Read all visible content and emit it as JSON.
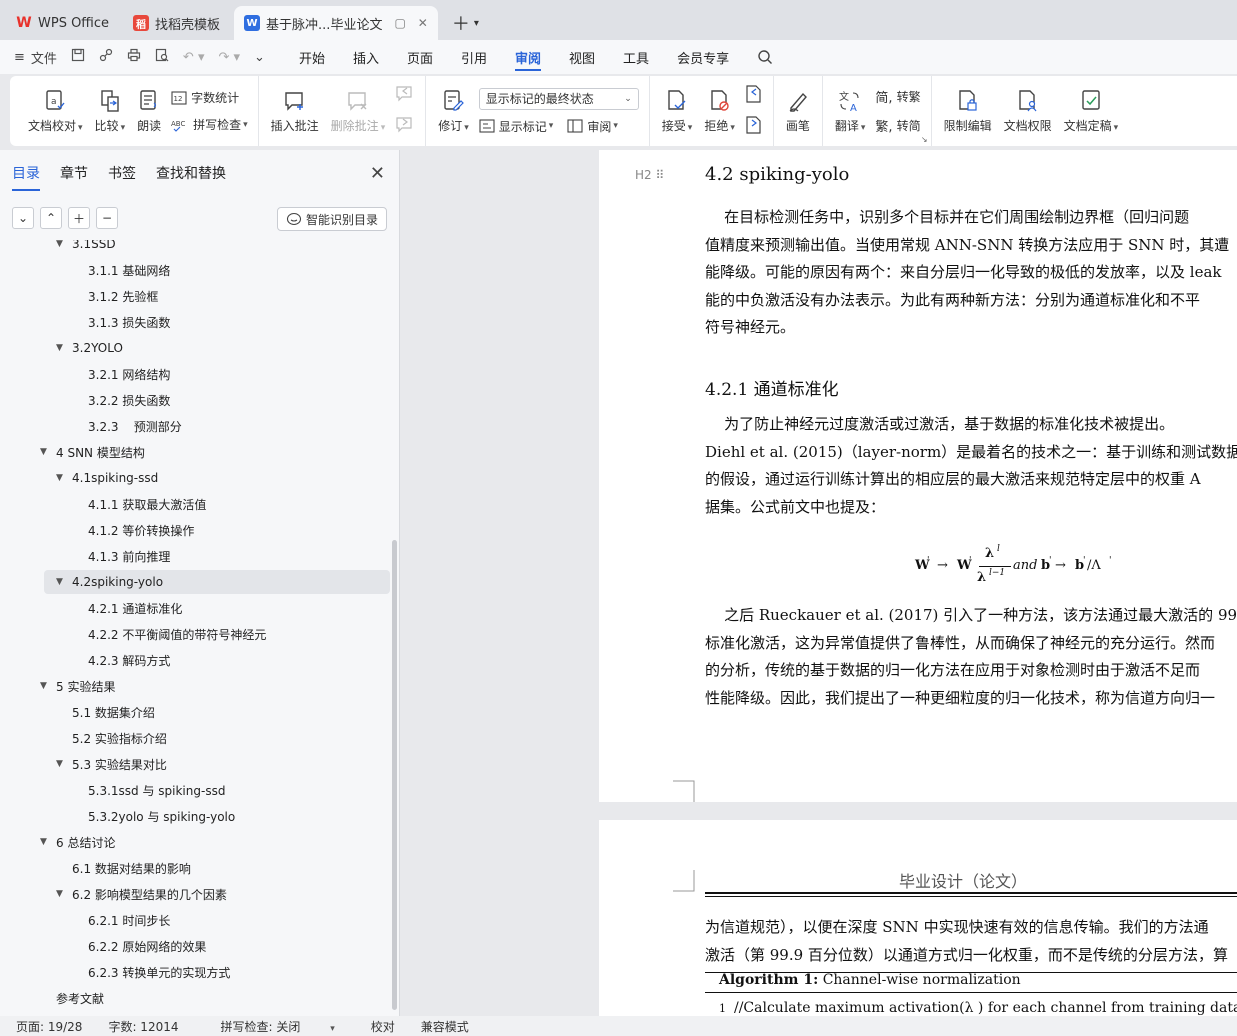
{
  "tabs": [
    {
      "label": "WPS Office",
      "logo": "wps-logo"
    },
    {
      "label": "找稻壳模板",
      "logo": "daoke-logo"
    },
    {
      "label": "基于脉冲...毕业论文",
      "logo": "writer-logo",
      "active": true
    }
  ],
  "menubar": {
    "file_label": "文件",
    "tabs": [
      "开始",
      "插入",
      "页面",
      "引用",
      "审阅",
      "视图",
      "工具",
      "会员专享"
    ],
    "active_tab": "审阅"
  },
  "ribbon": {
    "doc_check": "文档校对",
    "compare": "比较",
    "read_aloud": "朗读",
    "word_count": "字数统计",
    "spell_check": "拼写检查",
    "insert_comment": "插入批注",
    "delete_comment": "删除批注",
    "track_changes": "修订",
    "markup_state": "显示标记的最终状态",
    "show_markup": "显示标记",
    "review": "审阅",
    "accept": "接受",
    "reject": "拒绝",
    "pen": "画笔",
    "translate": "翻译",
    "to_traditional": "转繁",
    "to_simplified": "转简",
    "restrict_edit": "限制编辑",
    "doc_permission": "文档权限",
    "doc_finalize": "文档定稿"
  },
  "sidebar": {
    "tabs": [
      "目录",
      "章节",
      "书签",
      "查找和替换"
    ],
    "active_tab": "目录",
    "smart_toc": "智能识别目录",
    "toc": [
      {
        "text": "3.1SSD",
        "level": 2,
        "expanded": true
      },
      {
        "text": "3.1.1 基础网络",
        "level": 3
      },
      {
        "text": "3.1.2 先验框",
        "level": 3
      },
      {
        "text": "3.1.3 损失函数",
        "level": 3
      },
      {
        "text": "3.2YOLO",
        "level": 2,
        "expanded": true
      },
      {
        "text": "3.2.1 网络结构",
        "level": 3
      },
      {
        "text": "3.2.2 损失函数",
        "level": 3
      },
      {
        "text": "3.2.3    预测部分",
        "level": 3
      },
      {
        "text": "4 SNN 模型结构",
        "level": 1,
        "expanded": true
      },
      {
        "text": "4.1spiking-ssd",
        "level": 2,
        "expanded": true
      },
      {
        "text": "4.1.1 获取最大激活值",
        "level": 3
      },
      {
        "text": "4.1.2 等价转换操作",
        "level": 3
      },
      {
        "text": "4.1.3 前向推理",
        "level": 3
      },
      {
        "text": "4.2spiking-yolo",
        "level": 2,
        "expanded": true,
        "selected": true
      },
      {
        "text": "4.2.1 通道标准化",
        "level": 3
      },
      {
        "text": "4.2.2 不平衡阈值的带符号神经元",
        "level": 3
      },
      {
        "text": "4.2.3 解码方式",
        "level": 3
      },
      {
        "text": "5 实验结果",
        "level": 1,
        "expanded": true
      },
      {
        "text": "5.1 数据集介绍",
        "level": 2
      },
      {
        "text": "5.2 实验指标介绍",
        "level": 2
      },
      {
        "text": "5.3 实验结果对比",
        "level": 2,
        "expanded": true
      },
      {
        "text": "5.3.1ssd 与 spiking-ssd",
        "level": 3
      },
      {
        "text": "5.3.2yolo 与 spiking-yolo",
        "level": 3
      },
      {
        "text": "6 总结讨论",
        "level": 1,
        "expanded": true
      },
      {
        "text": "6.1 数据对结果的影响",
        "level": 2
      },
      {
        "text": "6.2 影响模型结果的几个因素",
        "level": 2,
        "expanded": true
      },
      {
        "text": "6.2.1 时间步长",
        "level": 3
      },
      {
        "text": "6.2.2 原始网络的效果",
        "level": 3
      },
      {
        "text": "6.2.3 转换单元的实现方式",
        "level": 3
      },
      {
        "text": "参考文献",
        "level": 1
      }
    ]
  },
  "document": {
    "heading_mark": "H2",
    "h2": "4.2    spiking-yolo",
    "para1": [
      "    在目标检测任务中，识别多个目标并在它们周围绘制边界框（回归问题",
      "值精度来预测输出值。当使用常规 ANN-SNN 转换方法应用于 SNN 时，其遭",
      "能降级。可能的原因有两个：来自分层归一化导致的极低的发放率，以及 leak",
      "能的中负激活没有办法表示。为此有两种新方法：分别为通道标准化和不平",
      "符号神经元。"
    ],
    "h3": "4.2.1    通道标准化",
    "para2": [
      "    为了防止神经元过度激活或过激活，基于数据的标准化技术被提出。",
      "Diehl et al. (2015)（layer-norm）是最着名的技术之一：基于训练和测试数据集",
      "的假设，通过运行训练计算出的相应层的最大激活来规范特定层中的权重 A",
      "据集。公式前文中也提及："
    ],
    "formula": {
      "w1": "W",
      "w2": "W",
      "lam_top": "λ",
      "sup_top": "l",
      "lam_bot": "λ",
      "sup_bot": "l−1",
      "and": "and",
      "b_part": "b",
      "b_res": "b",
      "div_lam": "/Λ"
    },
    "para3": [
      "    之后 Rueckauer et al. (2017) 引入了一种方法，该方法通过最大激活的 99",
      "标准化激活，这为异常值提供了鲁棒性，从而确保了神经元的充分运行。然而",
      "的分析，传统的基于数据的归一化方法在应用于对象检测时由于激活不足而",
      "性能降级。因此，我们提出了一种更细粒度的归一化技术，称为信道方向归一"
    ],
    "page2_header": "毕业设计（论文）",
    "para4": [
      "为信道规范），以便在深度 SNN 中实现快速有效的信息传输。我们的方法通",
      "激活（第 99.9 百分位数）以通道方式归一化权重，而不是传统的分层方法，算"
    ],
    "algorithm_title_bold": "Algorithm 1:",
    "algorithm_title": " Channel-wise normalization",
    "algorithm_line1_no": "1",
    "algorithm_line1": "//Calculate maximum activation(λ ) for each channel from training dataset"
  },
  "statusbar": {
    "page": "页面: 19/28",
    "word_count": "字数: 12014",
    "spell_check": "拼写检查: 关闭",
    "proofread": "校对",
    "compat_mode": "兼容模式"
  }
}
